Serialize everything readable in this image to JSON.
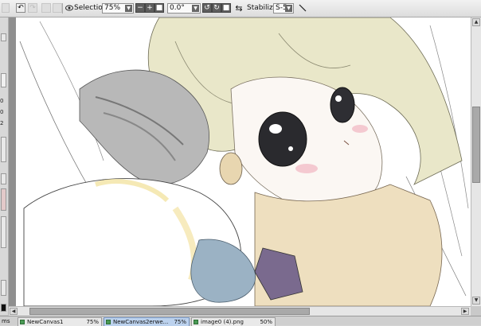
{
  "toolbar": {
    "selection_label": "Selection",
    "zoom_value": "75%",
    "rotation_value": "0.0°",
    "stabilizer_label": "Stabilizer",
    "stabilizer_value": "S-5",
    "icons": [
      "undo-icon",
      "redo-icon",
      "eye-icon",
      "zoom-out-icon",
      "zoom-in-icon",
      "zoom-reset-icon",
      "rotate-ccw-icon",
      "rotate-cw-icon",
      "rotate-reset-icon",
      "flip-icon",
      "line-tool-icon"
    ]
  },
  "left_panel": {
    "numbers": [
      "0",
      "0",
      "2"
    ]
  },
  "tabs": {
    "lead_label": "ms",
    "items": [
      {
        "name": "NewCanvas1",
        "zoom": "75%",
        "active": false
      },
      {
        "name": "NewCanvas2erwe...",
        "zoom": "75%",
        "active": true
      },
      {
        "name": "image0 (4).png",
        "zoom": "50%",
        "active": false
      }
    ]
  },
  "colors": {
    "active_tab": "#bcd2ee",
    "toolbar_bg": "#e6e6e6",
    "canvas_bg": "#ffffff"
  }
}
